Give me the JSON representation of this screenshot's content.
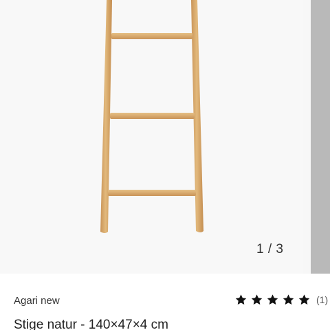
{
  "gallery": {
    "counter": "1 / 3",
    "image_description_icon": "wooden-ladder-image"
  },
  "product": {
    "brand": "Agari new",
    "title": "Stige natur - 140×47×4 cm",
    "rating": {
      "stars": 5,
      "max_stars": 5,
      "count_label": "(1)"
    }
  },
  "colors": {
    "wood": "#d9ad6c",
    "wood_shadow": "#c7955a",
    "gallery_bg": "#f8f8f8",
    "next_slide_bg": "#b9b9b9",
    "star": "#111111"
  }
}
